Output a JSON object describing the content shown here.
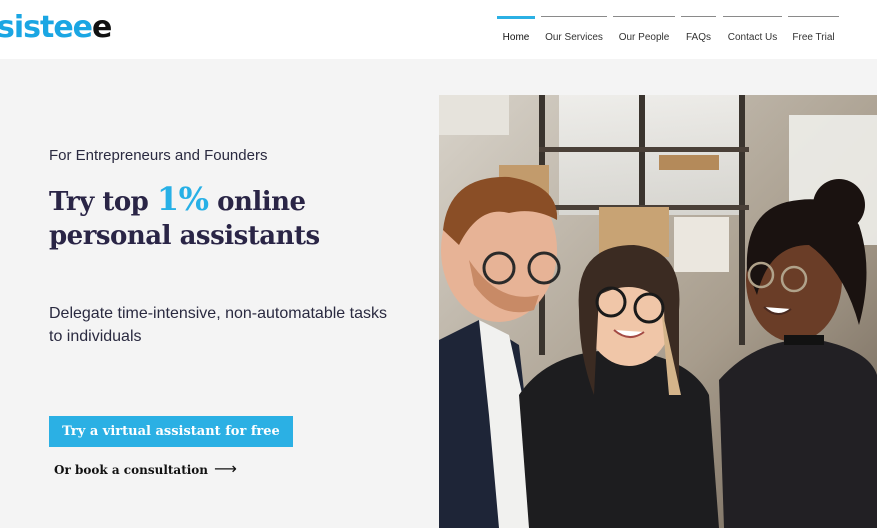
{
  "brand": {
    "logo_main": "sistee",
    "logo_tail": "e"
  },
  "nav": {
    "items": [
      {
        "label": "Home",
        "active": true
      },
      {
        "label": "Our Services",
        "active": false
      },
      {
        "label": "Our People",
        "active": false
      },
      {
        "label": "FAQs",
        "active": false
      },
      {
        "label": "Contact Us",
        "active": false
      },
      {
        "label": "Free Trial",
        "active": false
      }
    ]
  },
  "hero": {
    "eyebrow": "For Entrepreneurs and Founders",
    "headline_part1": "Try top ",
    "headline_accent": "1%",
    "headline_part2": " online",
    "headline_line2": "personal assistants",
    "subtext": "Delegate time-intensive, non-automatable tasks to individuals",
    "cta_label": "Try a virtual assistant for free",
    "secondary_label": "Or book a consultation",
    "secondary_arrow": "⟶"
  },
  "colors": {
    "accent": "#2bb0e4",
    "headline": "#2a2546",
    "background": "#f4f4f4"
  }
}
